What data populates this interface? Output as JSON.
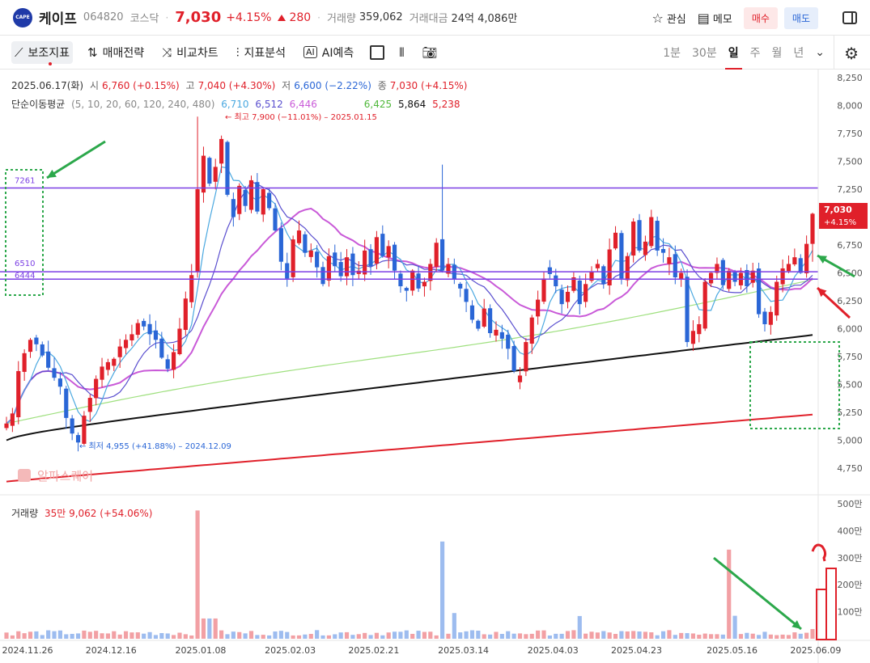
{
  "header": {
    "logo_text": "CAPE",
    "name": "케이프",
    "code": "064820",
    "market": "코스닥",
    "price": "7,030",
    "change_pct": "+4.15%",
    "change": "280",
    "volume_label": "거래량",
    "volume": "359,062",
    "amount_label": "거래대금",
    "amount": "24억 4,086만",
    "watch_label": "관심",
    "memo_label": "메모",
    "buy_label": "매수",
    "sell_label": "매도"
  },
  "toolbar": {
    "items": [
      "보조지표",
      "매매전략",
      "비교차트",
      "지표분석",
      "AI예측"
    ],
    "timeframes": [
      "1분",
      "30분",
      "일",
      "주",
      "월",
      "년"
    ],
    "selected_timeframe": "일"
  },
  "ohlc": {
    "date": "2025.06.17(화)",
    "open_label": "시",
    "open": "6,760 (+0.15%)",
    "high_label": "고",
    "high": "7,040 (+4.30%)",
    "low_label": "저",
    "low": "6,600 (−2.22%)",
    "close_label": "종",
    "close": "7,030 (+4.15%)"
  },
  "ma": {
    "label": "단순이동평균",
    "periods": "(5, 10, 20, 60, 120, 240, 480)",
    "values": [
      "6,710",
      "6,512",
      "6,446",
      "6,425",
      "5,864",
      "5,238"
    ],
    "colors": [
      "#4aa8e0",
      "#5a4fcf",
      "#c95ad8",
      "#7dd35a",
      "#111111",
      "#e0202a"
    ]
  },
  "annotations": {
    "high": "최고 7,900 (−11.01%) – 2025.01.15",
    "low": "최저 4,955 (+41.88%) – 2024.12.09",
    "line1": "7261",
    "line2": "6510",
    "line3": "6444",
    "watermark": "알파스퀘어",
    "price_tag_1": "7,030",
    "price_tag_2": "+4.15%"
  },
  "volume_info": {
    "label": "거래량",
    "value": "35만 9,062 (+54.06%)"
  },
  "colors": {
    "up": "#e0202a",
    "down": "#2a66d6",
    "vol_up": "#f2a0a4",
    "vol_down": "#9dbcef",
    "hline": "#7b3fe4"
  },
  "chart_data": {
    "type": "candlestick",
    "y_ticks": [
      "8,250",
      "8,000",
      "7,750",
      "7,500",
      "7,250",
      "7,000",
      "6,750",
      "6,500",
      "6,250",
      "6,000",
      "5,750",
      "5,500",
      "5,250",
      "5,000",
      "4,750"
    ],
    "ylim": [
      4600,
      8300
    ],
    "vol_ticks": [
      "500만",
      "400만",
      "300만",
      "200만",
      "100만"
    ],
    "vol_ylim": [
      0,
      5000000
    ],
    "x_labels": [
      "2024.11.26",
      "2024.12.16",
      "2025.01.08",
      "2025.02.03",
      "2025.02.21",
      "2025.03.14",
      "2025.04.03",
      "2025.04.23",
      "2025.05.16",
      "2025.06.09"
    ],
    "x_label_index": [
      0,
      14,
      29,
      44,
      58,
      73,
      88,
      102,
      118,
      132
    ],
    "horizontal_lines": [
      7261,
      6510,
      6444
    ],
    "closes": [
      5150,
      5240,
      5620,
      5780,
      5900,
      5860,
      5760,
      5650,
      5560,
      5480,
      5200,
      5060,
      4980,
      5220,
      5380,
      5550,
      5660,
      5700,
      5730,
      5840,
      5900,
      5950,
      6050,
      6020,
      5950,
      5900,
      5740,
      5640,
      5790,
      6000,
      6270,
      6480,
      7250,
      7550,
      7300,
      7450,
      7700,
      7200,
      7000,
      7280,
      7100,
      7330,
      7050,
      7250,
      7080,
      6880,
      6600,
      6450,
      6800,
      6880,
      6680,
      6700,
      6550,
      6400,
      6650,
      6560,
      6470,
      6640,
      6480,
      6520,
      6700,
      6560,
      6820,
      6650,
      6740,
      6520,
      6380,
      6340,
      6520,
      6360,
      6420,
      6580,
      6770,
      6520,
      6580,
      6440,
      6360,
      6240,
      6080,
      6000,
      6180,
      5960,
      5990,
      5910,
      5820,
      5620,
      5580,
      5880,
      6100,
      6260,
      6450,
      6490,
      6380,
      6220,
      6330,
      6460,
      6220,
      6400,
      6510,
      6580,
      6400,
      6710,
      6860,
      6450,
      6650,
      6960,
      6700,
      6780,
      7000,
      6700,
      6680,
      6640,
      6460,
      6500,
      5880,
      5980,
      6040,
      6420,
      6500,
      6580,
      6390,
      6520,
      6420,
      6500,
      6380,
      6520,
      6130,
      6040,
      6150,
      6420,
      6540,
      6580,
      6640,
      6500,
      6760,
      7030
    ],
    "volume_spikes": {
      "32": 4750000,
      "73": 3600000,
      "121": 3300000
    }
  }
}
